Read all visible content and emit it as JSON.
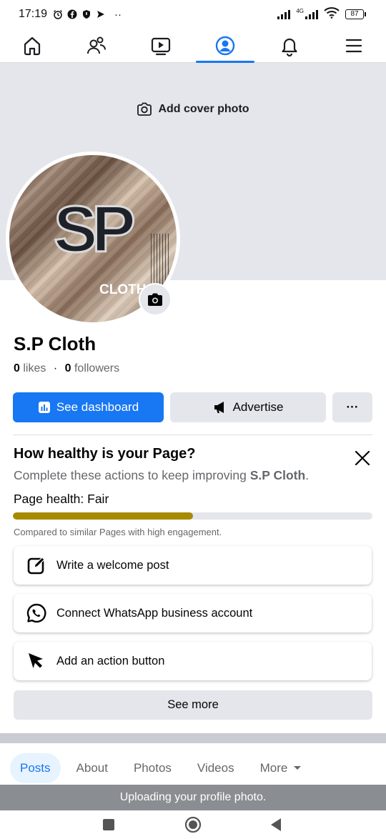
{
  "status_bar": {
    "time": "17:19",
    "overflow": "··",
    "network_label": "4G",
    "battery": "87"
  },
  "top_nav": {
    "items": [
      {
        "name": "home-icon",
        "active": false
      },
      {
        "name": "friends-icon",
        "active": false
      },
      {
        "name": "video-icon",
        "active": false
      },
      {
        "name": "profile-icon",
        "active": true
      },
      {
        "name": "bell-icon",
        "active": false
      },
      {
        "name": "menu-icon",
        "active": false
      }
    ],
    "accent": "#1877f2"
  },
  "cover": {
    "add_cover_label": "Add cover photo"
  },
  "profile_picture": {
    "logo_text": "SP",
    "logo_word": "CLOTH"
  },
  "page": {
    "name": "S.P Cloth",
    "likes_count": "0",
    "likes_label": "likes",
    "separator": "·",
    "followers_count": "0",
    "followers_label": "followers"
  },
  "actions": {
    "dashboard_label": "See dashboard",
    "advertise_label": "Advertise",
    "more_label": "···"
  },
  "health": {
    "title": "How healthy is your Page?",
    "subtitle_prefix": "Complete these actions to keep improving ",
    "subtitle_page": "S.P Cloth",
    "subtitle_suffix": ".",
    "status_label": "Page health: Fair",
    "progress": 0.5,
    "progress_color": "#a68a00",
    "note": "Compared to similar Pages with high engagement.",
    "tasks": [
      {
        "label": "Write a welcome post",
        "icon": "edit-icon"
      },
      {
        "label": "Connect WhatsApp business account",
        "icon": "whatsapp-icon"
      },
      {
        "label": "Add an action button",
        "icon": "cursor-icon"
      }
    ],
    "see_more_label": "See more"
  },
  "tabs": [
    {
      "label": "Posts",
      "active": true
    },
    {
      "label": "About",
      "active": false
    },
    {
      "label": "Photos",
      "active": false
    },
    {
      "label": "Videos",
      "active": false
    },
    {
      "label": "More",
      "active": false
    }
  ],
  "toast": {
    "message": "Uploading your profile photo."
  }
}
